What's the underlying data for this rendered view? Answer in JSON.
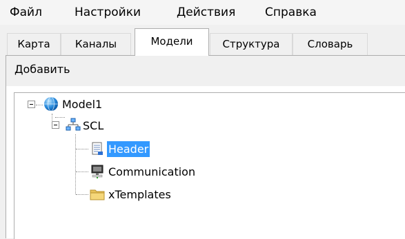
{
  "menu": {
    "items": [
      "Файл",
      "Настройки",
      "Действия",
      "Справка"
    ]
  },
  "tabs": [
    {
      "label": "Карта",
      "active": false
    },
    {
      "label": "Каналы",
      "active": false
    },
    {
      "label": "Модели",
      "active": true
    },
    {
      "label": "Структура",
      "active": false
    },
    {
      "label": "Словарь",
      "active": false
    }
  ],
  "toolbar": {
    "add_label": "Добавить"
  },
  "tree": {
    "root": {
      "label": "Model1",
      "icon": "globe-icon",
      "expanded": true
    },
    "scl": {
      "label": "SCL",
      "icon": "network-icon",
      "expanded": true
    },
    "children": [
      {
        "label": "Header",
        "icon": "document-icon",
        "selected": true
      },
      {
        "label": "Communication",
        "icon": "computer-icon",
        "selected": false
      },
      {
        "label": "xTemplates",
        "icon": "folder-icon",
        "selected": false
      }
    ]
  },
  "colors": {
    "selection": "#3399ff",
    "background": "#f0f0f0",
    "folder": "#f5d77a"
  }
}
